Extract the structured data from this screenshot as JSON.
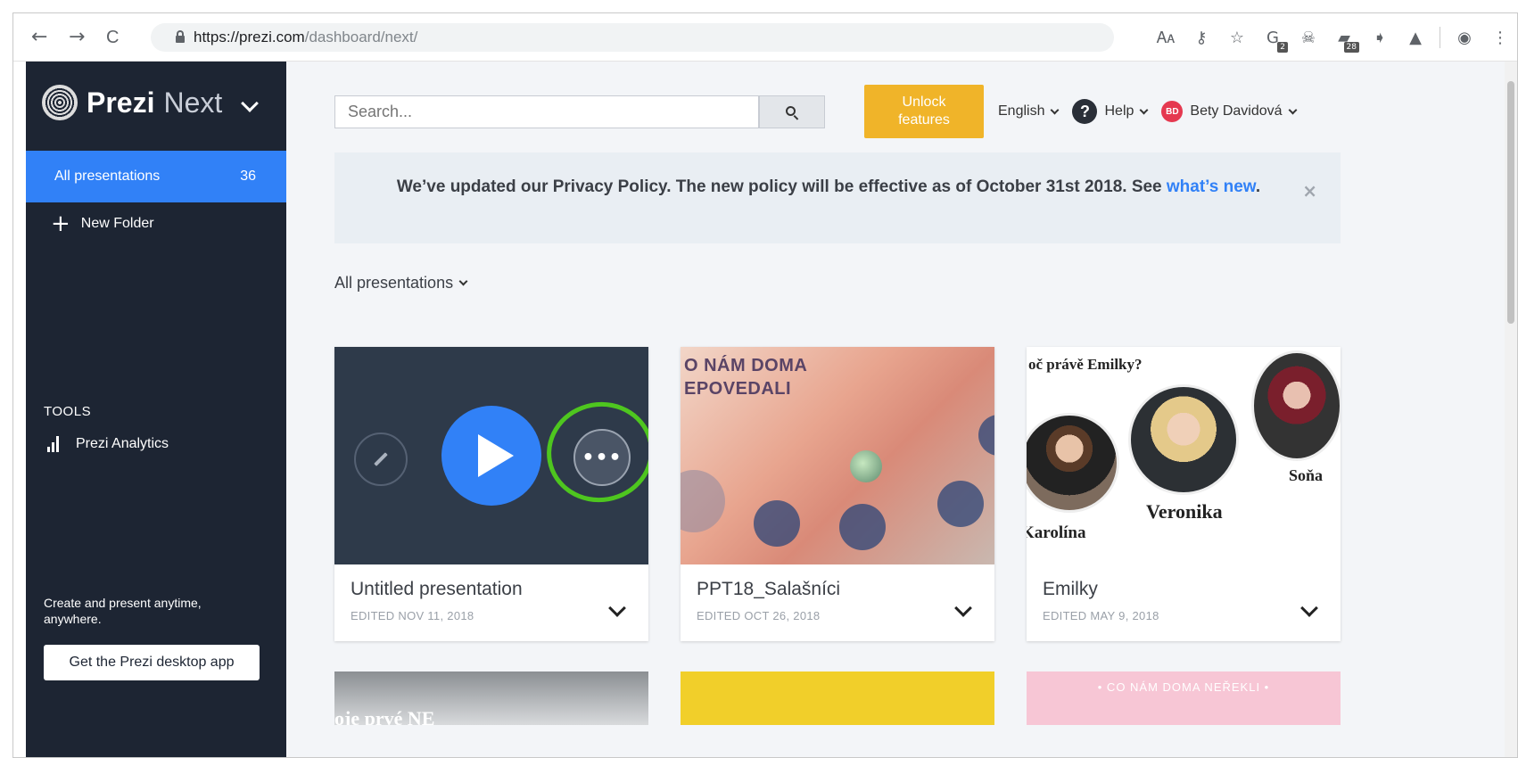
{
  "browser": {
    "url_host": "https://prezi.com",
    "url_path": "/dashboard/next/",
    "back": "←",
    "forward": "→",
    "reload": "C",
    "extensions": [
      {
        "name": "translate-icon",
        "glyph": "🗛",
        "badge": ""
      },
      {
        "name": "key-icon",
        "glyph": "⚷",
        "badge": ""
      },
      {
        "name": "star-icon",
        "glyph": "☆",
        "badge": ""
      },
      {
        "name": "extension-g-icon",
        "glyph": "G",
        "badge": "2"
      },
      {
        "name": "pirate-icon",
        "glyph": "☠",
        "badge": ""
      },
      {
        "name": "folder-ext-icon",
        "glyph": "▰",
        "badge": "28"
      },
      {
        "name": "arrow-ext-icon",
        "glyph": "➧",
        "badge": ""
      },
      {
        "name": "drive-ext-icon",
        "glyph": "▲",
        "badge": ""
      },
      {
        "name": "profile-icon",
        "glyph": "◉",
        "badge": ""
      }
    ],
    "menu": "⋮"
  },
  "sidebar": {
    "brand_name": "Prezi",
    "brand_sub": "Next",
    "active_item": {
      "label": "All presentations",
      "count": "36"
    },
    "new_folder": "New Folder",
    "tools_title": "TOOLS",
    "analytics": "Prezi Analytics",
    "cta_text": "Create and present anytime, anywhere.",
    "desktop_button": "Get the Prezi desktop app"
  },
  "header": {
    "search_placeholder": "Search...",
    "unlock_line1": "Unlock",
    "unlock_line2": "features",
    "language": "English",
    "help": "Help",
    "user_initials": "BD",
    "user_name": "Bety Davidová"
  },
  "notice": {
    "text": "We’ve updated our Privacy Policy. The new policy will be effective as of October 31st 2018. See ",
    "link": "what’s new",
    "end": ".",
    "close": "×"
  },
  "filter": {
    "label": "All presentations"
  },
  "cards": [
    {
      "title": "Untitled presentation",
      "date": "EDITED NOV 11, 2018"
    },
    {
      "title": "PPT18_Salašníci",
      "date": "EDITED OCT 26, 2018",
      "thumb_line1": "O NÁM DOMA",
      "thumb_line2": "EPOVEDALI"
    },
    {
      "title": "Emilky",
      "date": "EDITED MAY 9, 2018",
      "thumb_heading": "oč právě Emilky?",
      "names": [
        "Karolína",
        "Veronika",
        "Soňa"
      ]
    }
  ],
  "row2": {
    "card1_text": "oje prvé NE",
    "card3_text": "• CO NÁM DOMA NEŘEKLI •"
  },
  "colors": {
    "sidebar_bg": "#1d2533",
    "accent_blue": "#3181f7",
    "unlock_yellow": "#f0b429",
    "highlight_green": "#4ec61f"
  }
}
